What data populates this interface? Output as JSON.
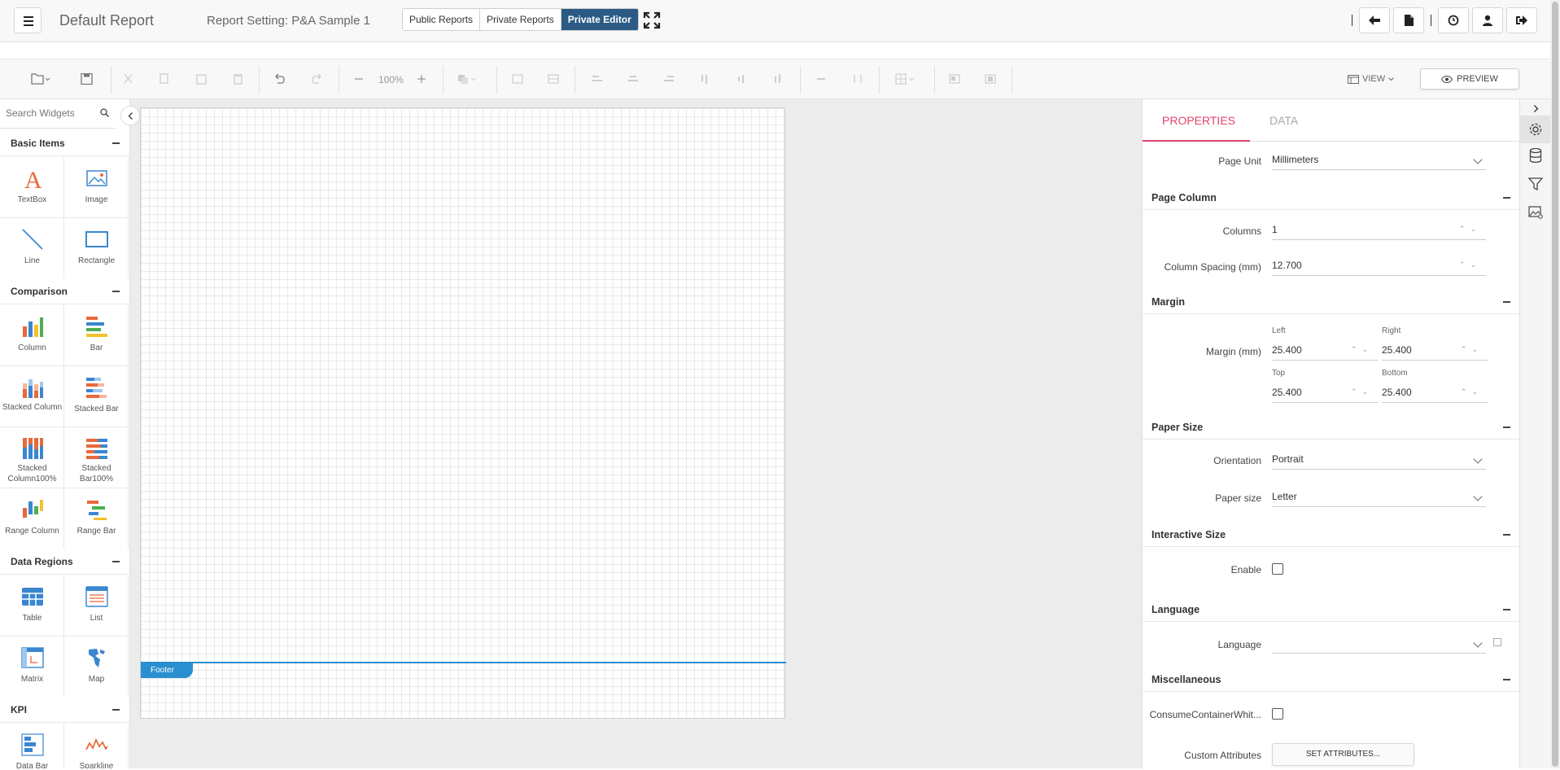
{
  "header": {
    "app_title": "Default Report",
    "report_setting": "Report Setting: P&A Sample 1",
    "tabs": [
      {
        "label": "Public Reports",
        "active": false
      },
      {
        "label": "Private Reports",
        "active": false
      },
      {
        "label": "Private Editor",
        "active": true
      }
    ],
    "accent_color": "#2b5b84"
  },
  "toolbar": {
    "zoom": "100%",
    "view_label": "VIEW",
    "preview_label": "PREVIEW"
  },
  "widgets": {
    "search_placeholder": "Search Widgets",
    "categories": [
      {
        "name": "Basic Items",
        "items": [
          "TextBox",
          "Image",
          "Line",
          "Rectangle"
        ]
      },
      {
        "name": "Comparison",
        "items": [
          "Column",
          "Bar",
          "Stacked Column",
          "Stacked Bar",
          "Stacked Column100%",
          "Stacked Bar100%",
          "Range Column",
          "Range Bar"
        ]
      },
      {
        "name": "Data Regions",
        "items": [
          "Table",
          "List",
          "Matrix",
          "Map"
        ]
      },
      {
        "name": "KPI",
        "items": [
          "Data Bar",
          "Sparkline"
        ]
      }
    ]
  },
  "canvas": {
    "footer_label": "Footer"
  },
  "properties": {
    "tab_properties": "PROPERTIES",
    "tab_data": "DATA",
    "active_tab_color": "#e0436b",
    "page_unit_label": "Page Unit",
    "page_unit_value": "Millimeters",
    "sections": {
      "page_column": "Page Column",
      "margin": "Margin",
      "paper_size": "Paper Size",
      "interactive_size": "Interactive Size",
      "language": "Language",
      "miscellaneous": "Miscellaneous"
    },
    "columns_label": "Columns",
    "columns_value": "1",
    "column_spacing_label": "Column Spacing (mm)",
    "column_spacing_value": "12.700",
    "margin_label": "Margin (mm)",
    "margin_left_label": "Left",
    "margin_right_label": "Right",
    "margin_top_label": "Top",
    "margin_bottom_label": "Bottom",
    "margin_left": "25.400",
    "margin_right": "25.400",
    "margin_top": "25.400",
    "margin_bottom": "25.400",
    "orientation_label": "Orientation",
    "orientation_value": "Portrait",
    "paper_size_label": "Paper size",
    "paper_size_value": "Letter",
    "enable_label": "Enable",
    "language_label": "Language",
    "language_value": "",
    "consume_label": "ConsumeContainerWhit...",
    "custom_attributes_label": "Custom Attributes",
    "set_attributes_label": "SET ATTRIBUTES..."
  }
}
